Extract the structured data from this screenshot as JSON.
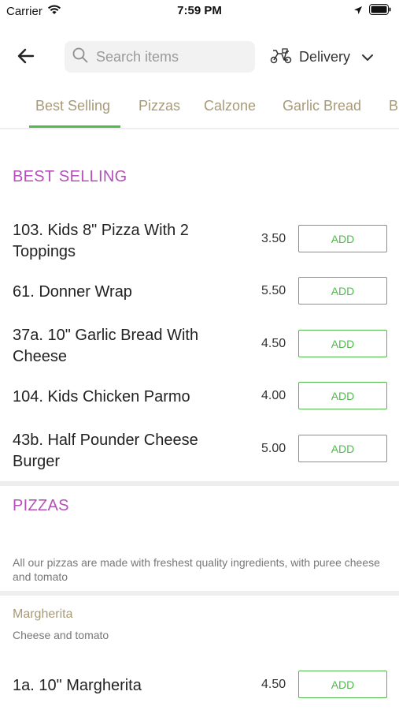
{
  "status_bar": {
    "carrier": "Carrier",
    "time": "7:59 PM"
  },
  "header": {
    "search_placeholder": "Search items",
    "delivery_label": "Delivery"
  },
  "tabs": [
    {
      "label": "Best Selling"
    },
    {
      "label": "Pizzas"
    },
    {
      "label": "Calzone"
    },
    {
      "label": "Garlic Bread"
    },
    {
      "label": "B"
    }
  ],
  "sections": {
    "best_selling": {
      "title": "BEST SELLING",
      "items": [
        {
          "name": "103. Kids 8\" Pizza With 2 Toppings",
          "price": "3.50",
          "button": "ADD"
        },
        {
          "name": "61. Donner Wrap",
          "price": "5.50",
          "button": "ADD"
        },
        {
          "name": "37a. 10\" Garlic Bread With Cheese",
          "price": "4.50",
          "button": "ADD"
        },
        {
          "name": "104. Kids Chicken Parmo",
          "price": "4.00",
          "button": "ADD"
        },
        {
          "name": "43b. Half Pounder Cheese Burger",
          "price": "5.00",
          "button": "ADD"
        }
      ]
    },
    "pizzas": {
      "title": "PIZZAS",
      "description": "All our pizzas are made with freshest quality ingredients, with puree cheese and tomato",
      "subcategory": {
        "title": "Margherita",
        "description": "Cheese and tomato"
      },
      "items": [
        {
          "name": "1a. 10\" Margherita",
          "price": "4.50",
          "button": "ADD"
        }
      ]
    }
  },
  "colors": {
    "accent_green": "#52b94d",
    "section_purple": "#b450b8",
    "tab_tan": "#a89a78"
  },
  "icons": [
    "wifi-icon",
    "location-arrow-icon",
    "battery-icon",
    "back-arrow-icon",
    "search-icon",
    "scooter-icon",
    "chevron-down-icon"
  ]
}
